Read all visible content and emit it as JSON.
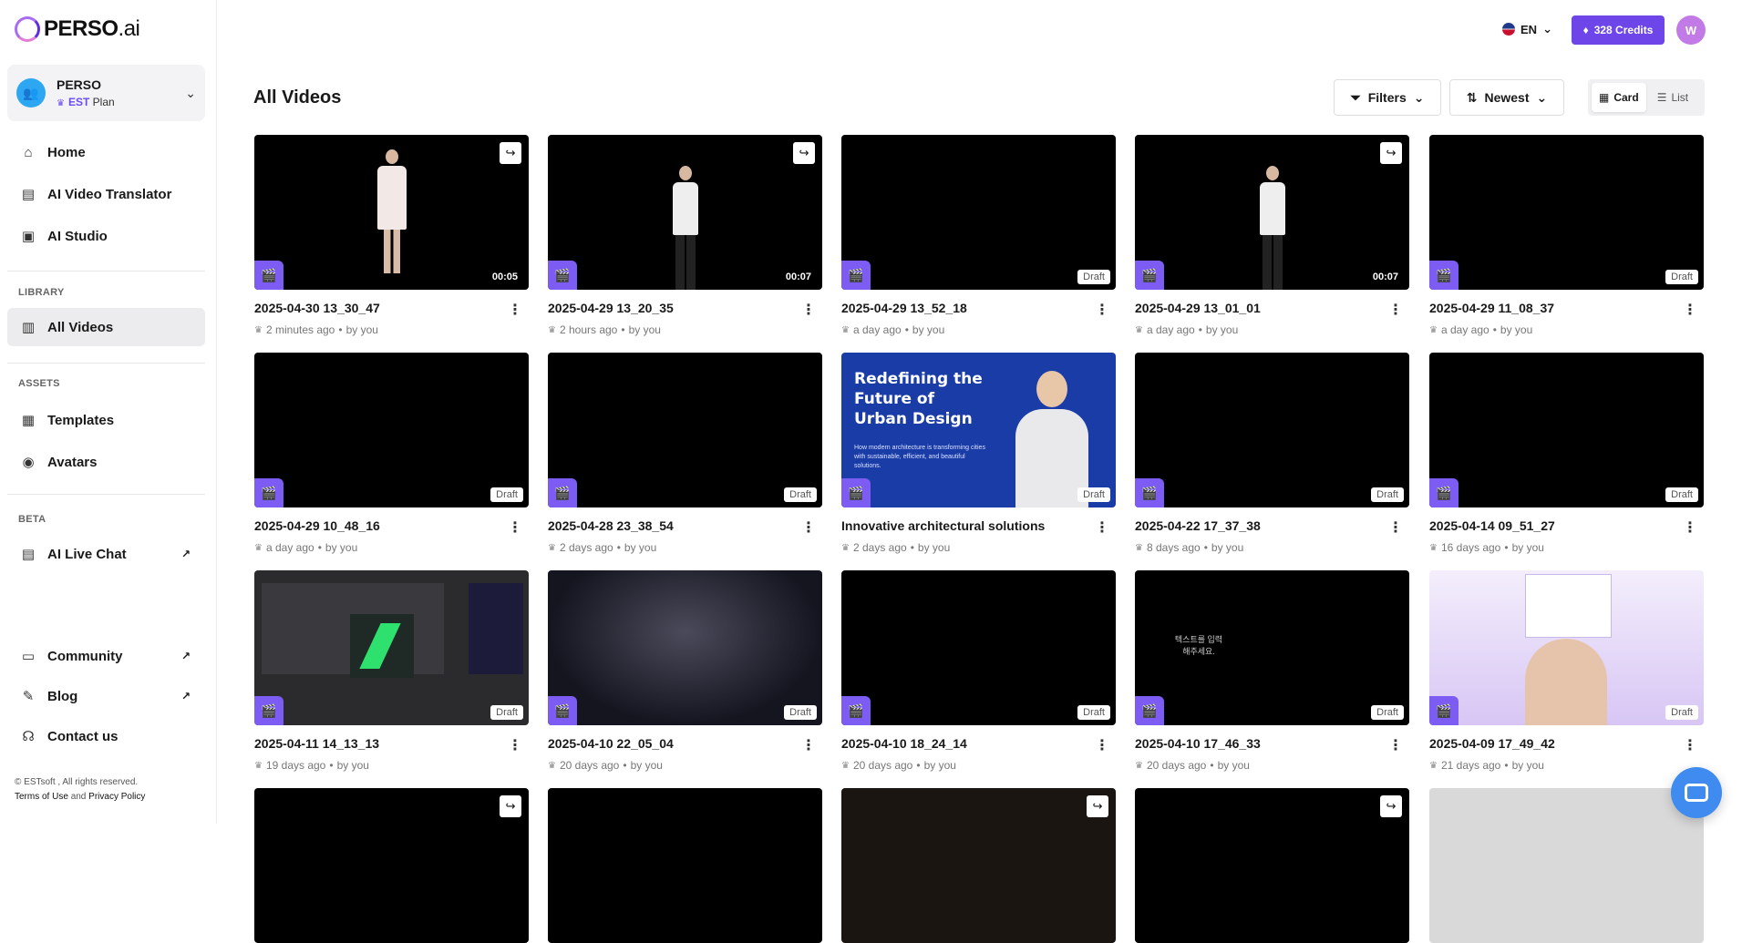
{
  "brand": {
    "name": "PERSO",
    "suffix": ".ai"
  },
  "workspace": {
    "name": "PERSO",
    "plan_name": "EST",
    "plan_label": "Plan"
  },
  "nav": {
    "home": "Home",
    "translator": "AI Video Translator",
    "studio": "AI Studio",
    "library_label": "LIBRARY",
    "all_videos": "All Videos",
    "assets_label": "ASSETS",
    "templates": "Templates",
    "avatars": "Avatars",
    "beta_label": "BETA",
    "live_chat": "AI Live Chat",
    "community": "Community",
    "blog": "Blog",
    "contact": "Contact us"
  },
  "footer": {
    "copyright": "© ESTsoft , All rights reserved.",
    "terms": "Terms of Use",
    "and": "and",
    "privacy": "Privacy Policy"
  },
  "topbar": {
    "lang": "EN",
    "credits": "328 Credits",
    "user_initial": "W"
  },
  "page": {
    "title": "All Videos",
    "filters": "Filters",
    "sort": "Newest",
    "view_card": "Card",
    "view_list": "List"
  },
  "videos": [
    {
      "title": "2025-04-30 13_30_47",
      "meta": "2 minutes ago",
      "by": "by you",
      "badge": "00:05"
    },
    {
      "title": "2025-04-29 13_20_35",
      "meta": "2 hours ago",
      "by": "by you",
      "badge": "00:07"
    },
    {
      "title": "2025-04-29 13_52_18",
      "meta": "a day ago",
      "by": "by you",
      "badge": "Draft"
    },
    {
      "title": "2025-04-29 13_01_01",
      "meta": "a day ago",
      "by": "by you",
      "badge": "00:07"
    },
    {
      "title": "2025-04-29 11_08_37",
      "meta": "a day ago",
      "by": "by you",
      "badge": "Draft"
    },
    {
      "title": "2025-04-29 10_48_16",
      "meta": "a day ago",
      "by": "by you",
      "badge": "Draft"
    },
    {
      "title": "2025-04-28 23_38_54",
      "meta": "2 days ago",
      "by": "by you",
      "badge": "Draft"
    },
    {
      "title": "Innovative architectural solutions",
      "meta": "2 days ago",
      "by": "by you",
      "badge": "Draft"
    },
    {
      "title": "2025-04-22 17_37_38",
      "meta": "8 days ago",
      "by": "by you",
      "badge": "Draft"
    },
    {
      "title": "2025-04-14 09_51_27",
      "meta": "16 days ago",
      "by": "by you",
      "badge": "Draft"
    },
    {
      "title": "2025-04-11 14_13_13",
      "meta": "19 days ago",
      "by": "by you",
      "badge": "Draft"
    },
    {
      "title": "2025-04-10 22_05_04",
      "meta": "20 days ago",
      "by": "by you",
      "badge": "Draft"
    },
    {
      "title": "2025-04-10 18_24_14",
      "meta": "20 days ago",
      "by": "by you",
      "badge": "Draft"
    },
    {
      "title": "2025-04-10 17_46_33",
      "meta": "20 days ago",
      "by": "by you",
      "badge": "Draft"
    },
    {
      "title": "2025-04-09 17_49_42",
      "meta": "21 days ago",
      "by": "by you",
      "badge": "Draft"
    }
  ],
  "slide": {
    "title": "Redefining the Future of Urban Design",
    "subtitle": "How modern architecture is transforming cities with sustainable, efficient, and beautiful solutions."
  },
  "korean_text": "텍스트를 입력해주세요."
}
